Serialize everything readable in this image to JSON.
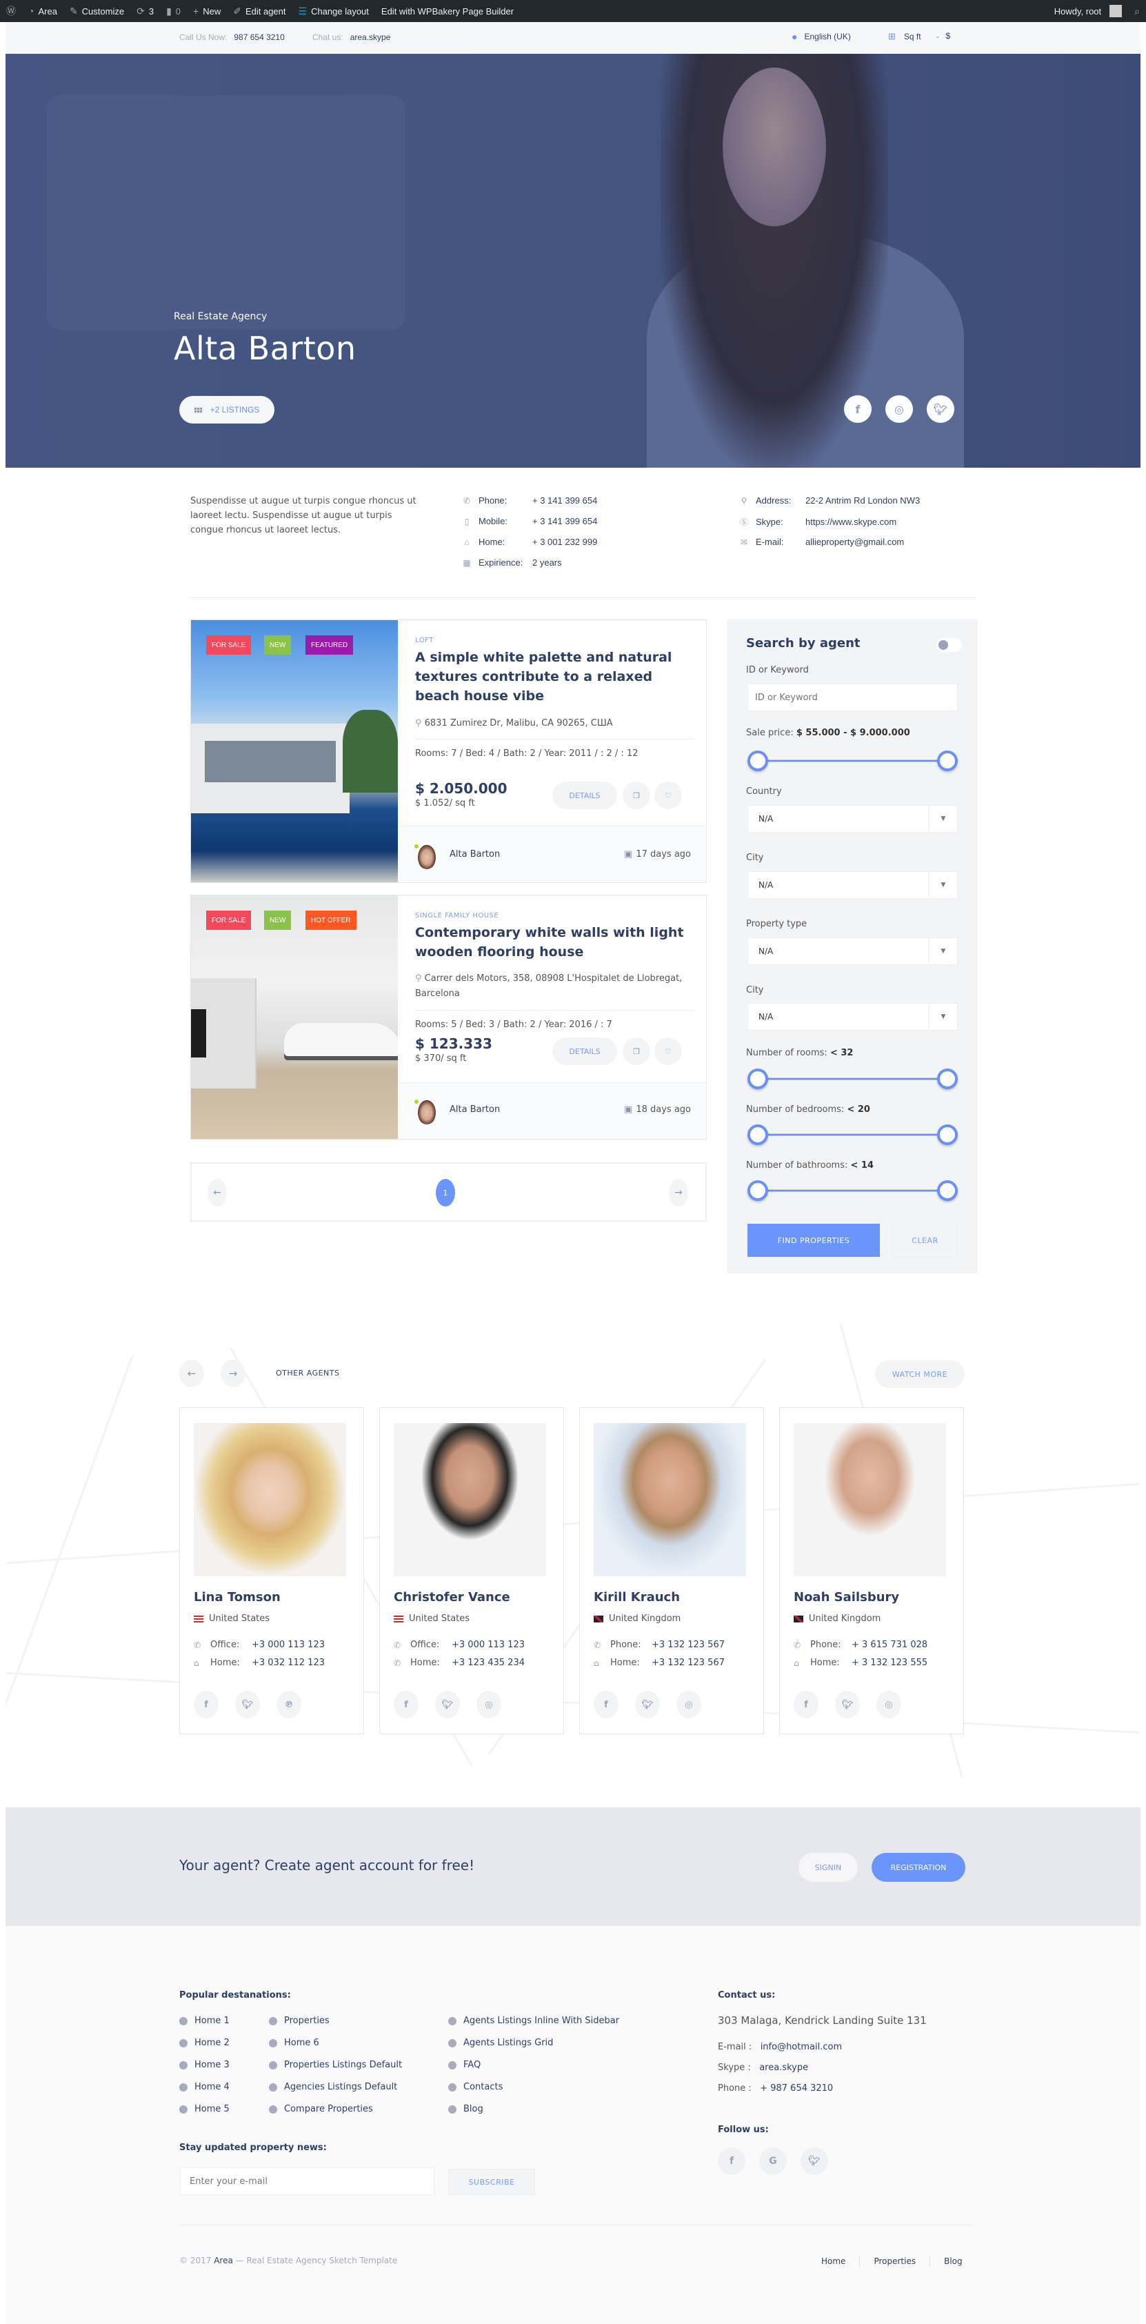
{
  "admin_bar": {
    "items": [
      "Area",
      "Customize",
      "3",
      "0",
      "New",
      "Edit agent",
      "Change layout",
      "Edit with WPBakery Page Builder"
    ],
    "greeting": "Howdy, root"
  },
  "topbar": {
    "call_label": "Call Us Now:",
    "call_value": "987 654 3210",
    "chat_label": "Chat us:",
    "chat_value": "area.skype",
    "language": "English (UK)",
    "unit": "Sq ft",
    "currency": "$"
  },
  "hero": {
    "subtitle": "Real Estate Agency",
    "name": "Alta Barton",
    "listings_button": "+2 LISTINGS",
    "socials": [
      "facebook",
      "instagram",
      "twitter"
    ]
  },
  "agent_info": {
    "description": "Suspendisse ut augue ut turpis congue rhoncus ut laoreet lectu. Suspendisse ut augue ut turpis congue rhoncus ut laoreet lectus.",
    "contacts_left": [
      {
        "icon": "phone-icon",
        "label": "Phone:",
        "value": "+ 3 141 399 654"
      },
      {
        "icon": "mobile-icon",
        "label": "Mobile:",
        "value": "+ 3 141 399 654"
      },
      {
        "icon": "home-icon",
        "label": "Home:",
        "value": "+ 3 001 232 999"
      },
      {
        "icon": "calendar-icon",
        "label": "Expirience:",
        "value": "2 years"
      }
    ],
    "contacts_right": [
      {
        "icon": "map-pin-icon",
        "label": "Address:",
        "value": "22-2 Antrim Rd London NW3"
      },
      {
        "icon": "skype-icon",
        "label": "Skype:",
        "value": "https://www.skype.com"
      },
      {
        "icon": "envelope-icon",
        "label": "E-mail:",
        "value": "allieproperty@gmail.com"
      }
    ]
  },
  "listings": [
    {
      "tags": [
        {
          "label": "FOR SALE",
          "color": "#f4485b"
        },
        {
          "label": "NEW",
          "color": "#8bc34a"
        },
        {
          "label": "FEATURED",
          "color": "#9c1aab"
        }
      ],
      "category": "LOFT",
      "title": "A simple white palette and natural textures contribute to a relaxed beach house vibe",
      "address": "6831 Zumirez Dr, Malibu, CA 90265, США",
      "meta": "Rooms: 7   /   Bed: 4   /   Bath: 2   /   Year: 2011   /   : 2   /   : 12",
      "price": "$ 2.050.000",
      "price_sqft": "$ 1.052/ sq ft",
      "details_label": "DETAILS",
      "agent": "Alta Barton",
      "date": "17 days ago"
    },
    {
      "tags": [
        {
          "label": "FOR SALE",
          "color": "#f4485b"
        },
        {
          "label": "NEW",
          "color": "#8bc34a"
        },
        {
          "label": "HOT OFFER",
          "color": "#ff5722"
        }
      ],
      "category": "SINGLE FAMILY HOUSE",
      "title": "Contemporary white walls with light wooden flooring house",
      "address": "Carrer dels Motors, 358, 08908 L'Hospitalet de Llobregat, Barcelona",
      "meta": "Rooms: 5   /   Bed: 3   /   Bath: 2   /   Year: 2016   /   : 7",
      "price": "$ 123.333",
      "price_sqft": "$ 370/ sq ft",
      "details_label": "DETAILS",
      "agent": "Alta Barton",
      "date": "18 days ago"
    }
  ],
  "pagination": {
    "current": "1"
  },
  "search": {
    "title": "Search by agent",
    "keyword_label": "ID or Keyword",
    "keyword_placeholder": "ID or Keyword",
    "price_label": "Sale price:",
    "price_value": "$ 55.000 - $ 9.000.000",
    "price_range_fraction": [
      0,
      1
    ],
    "country_label": "Country",
    "country_value": "N/A",
    "city_label": "City",
    "city_value": "N/A",
    "property_type_label": "Property type",
    "property_type_value": "N/A",
    "city2_label": "City",
    "city2_value": "N/A",
    "rooms_label": "Number of rooms:",
    "rooms_value": "< 32",
    "bedrooms_label": "Number of bedrooms:",
    "bedrooms_value": "< 20",
    "bathrooms_label": "Number of bathrooms:",
    "bathrooms_value": "< 14",
    "find_label": "FIND PROPERTIES",
    "clear_label": "CLEAR"
  },
  "other_agents": {
    "heading": "OTHER AGENTS",
    "watch_more": "WATCH MORE",
    "agents": [
      {
        "name": "Lina Tomson",
        "country": "United States",
        "flag": "us",
        "rows": [
          {
            "icon": "phone-icon",
            "label": "Office:",
            "value": "+3 000 113 123"
          },
          {
            "icon": "home-icon",
            "label": "Home:",
            "value": "+3 032 112 123"
          }
        ],
        "socials": [
          "facebook",
          "twitter",
          "pinterest"
        ]
      },
      {
        "name": "Christofer Vance",
        "country": "United States",
        "flag": "us",
        "rows": [
          {
            "icon": "phone-icon",
            "label": "Office:",
            "value": "+3 000 113 123"
          },
          {
            "icon": "phone-icon",
            "label": "Home:",
            "value": "+3 123 435 234"
          }
        ],
        "socials": [
          "facebook",
          "twitter",
          "instagram"
        ]
      },
      {
        "name": "Kirill Krauch",
        "country": "United Kingdom",
        "flag": "uk",
        "rows": [
          {
            "icon": "phone-icon",
            "label": "Phone:",
            "value": "+3 132 123 567"
          },
          {
            "icon": "home-icon",
            "label": "Home:",
            "value": "+3 132 123 567"
          }
        ],
        "socials": [
          "facebook",
          "twitter",
          "instagram"
        ]
      },
      {
        "name": "Noah Sailsbury",
        "country": "United Kingdom",
        "flag": "uk",
        "rows": [
          {
            "icon": "phone-icon",
            "label": "Phone:",
            "value": "+ 3 615 731 028"
          },
          {
            "icon": "home-icon",
            "label": "Home:",
            "value": "+ 3 132 123 555"
          }
        ],
        "socials": [
          "facebook",
          "twitter",
          "instagram"
        ]
      }
    ]
  },
  "cta": {
    "text": "Your agent? Create agent account for free!",
    "signin": "SIGNIN",
    "registration": "REGISTRATION"
  },
  "footer": {
    "popular_heading": "Popular destanations:",
    "links_col1": [
      "Home 1",
      "Home 2",
      "Home 3",
      "Home 4",
      "Home 5"
    ],
    "links_col2": [
      "Properties",
      "Home 6",
      "Properties Listings Default",
      "Agencies Listings Default",
      "Compare Properties"
    ],
    "links_col3": [
      "Agents Listings Inline With Sidebar",
      "Agents Listings Grid",
      "FAQ",
      "Contacts",
      "Blog"
    ],
    "newsletter_heading": "Stay updated property news:",
    "email_placeholder": "Enter your e-mail",
    "subscribe": "SUBSCRIBE",
    "contact_heading": "Contact us:",
    "address": "303 Malaga, Kendrick Landing Suite 131",
    "email_label": "E-mail :",
    "email_value": "info@hotmail.com",
    "skype_label": "Skype :",
    "skype_value": "area.skype",
    "phone_label": "Phone :",
    "phone_value": "+ 987 654 3210",
    "follow_heading": "Follow us:",
    "follow_socials": [
      "facebook",
      "google",
      "twitter"
    ],
    "copyright_prefix": "© 2017",
    "copyright_brand": "Area",
    "copyright_suffix": "— Real Estate Agency Sketch Template",
    "bottom_links": [
      "Home",
      "Properties",
      "Blog"
    ]
  }
}
